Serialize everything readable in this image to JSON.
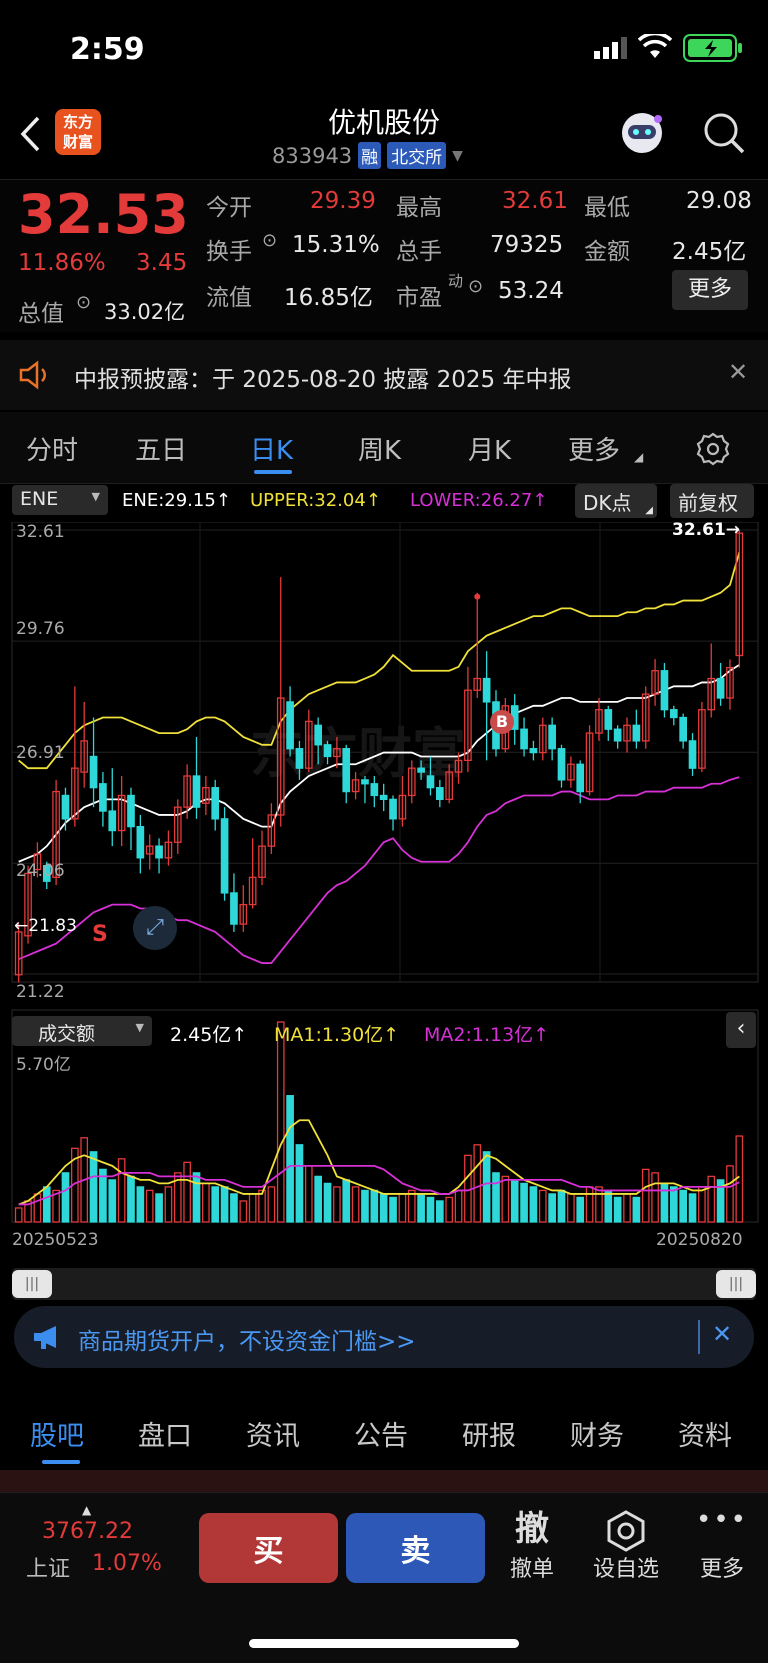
{
  "status": {
    "time": "2:59"
  },
  "nav": {
    "logo_line1": "东方",
    "logo_line2": "财富",
    "title": "优机股份",
    "code": "833943",
    "tag_margin": "融",
    "tag_exchange": "北交所"
  },
  "quote": {
    "price": "32.53",
    "change_pct": "11.86%",
    "change_amt": "3.45",
    "open_label": "今开",
    "open": "29.39",
    "high_label": "最高",
    "high": "32.61",
    "low_label": "最低",
    "low": "29.08",
    "turnover_label": "换手",
    "turnover": "15.31%",
    "vol_label": "总手",
    "vol": "79325",
    "amount_label": "金额",
    "amount": "2.45亿",
    "mcap_label": "总值",
    "mcap": "33.02亿",
    "float_label": "流值",
    "float": "16.85亿",
    "pe_label": "市盈",
    "pe_sup": "动",
    "pe": "53.24",
    "more": "更多"
  },
  "notice": {
    "text": "中报预披露：于 2025-08-20 披露 2025 年中报"
  },
  "tabs": [
    "分时",
    "五日",
    "日K",
    "周K",
    "月K",
    "更多"
  ],
  "indicator": {
    "name": "ENE",
    "ene": "ENE:29.15",
    "upper": "UPPER:32.04",
    "lower": "LOWER:26.27",
    "dk": "DK点",
    "adjust": "前复权",
    "last_tag": "32.61",
    "low_tag": "21.83",
    "s_mark": "S",
    "b_mark": "B"
  },
  "axis": {
    "y": [
      "32.61",
      "29.76",
      "26.91",
      "24.06",
      "21.22"
    ]
  },
  "volume": {
    "name": "成交额",
    "val": "2.45亿",
    "ma1": "MA1:1.30亿",
    "ma2": "MA2:1.13亿",
    "max": "5.70亿",
    "date_start": "20250523",
    "date_end": "20250820"
  },
  "banner": {
    "text": "商品期货开户，不设资金门槛>>"
  },
  "subtabs": [
    "股吧",
    "盘口",
    "资讯",
    "公告",
    "研报",
    "财务",
    "资料"
  ],
  "bottom": {
    "index_val": "3767.22",
    "index_name": "上证",
    "index_pct": "1.07%",
    "buy": "买",
    "sell": "卖",
    "cancel_top": "撤",
    "cancel": "撤单",
    "fav": "设自选",
    "more": "更多"
  },
  "colors": {
    "up": "#e33a3a",
    "down": "#2fd8d8",
    "accent": "#3b8ef0",
    "upper": "#f0e03a",
    "lower": "#d631d6",
    "ene": "#ffffff"
  },
  "chart_data": {
    "type": "candlestick",
    "y_range": [
      21.22,
      32.61
    ],
    "candles": [
      [
        21.2,
        22.3,
        21.0,
        22.5
      ],
      [
        22.2,
        23.8,
        22.0,
        24.0
      ],
      [
        23.9,
        24.3,
        23.7,
        24.6
      ],
      [
        24.0,
        23.6,
        23.4,
        24.1
      ],
      [
        23.7,
        25.9,
        23.5,
        26.2
      ],
      [
        25.8,
        25.2,
        24.9,
        26.0
      ],
      [
        25.2,
        26.5,
        25.0,
        28.6
      ],
      [
        26.4,
        27.2,
        26.0,
        28.2
      ],
      [
        26.8,
        26.0,
        25.5,
        27.8
      ],
      [
        26.1,
        25.4,
        25.0,
        26.4
      ],
      [
        25.4,
        24.9,
        24.5,
        26.5
      ],
      [
        24.9,
        25.8,
        24.5,
        26.3
      ],
      [
        25.8,
        25.0,
        24.4,
        26.0
      ],
      [
        25.0,
        24.2,
        23.8,
        25.3
      ],
      [
        24.3,
        24.5,
        23.9,
        24.8
      ],
      [
        24.5,
        24.2,
        23.8,
        24.7
      ],
      [
        24.2,
        24.6,
        24.0,
        24.9
      ],
      [
        24.6,
        25.5,
        24.3,
        25.7
      ],
      [
        25.5,
        26.3,
        25.2,
        26.6
      ],
      [
        26.3,
        25.5,
        25.2,
        27.3
      ],
      [
        25.6,
        26.0,
        25.3,
        26.3
      ],
      [
        26.0,
        25.2,
        24.9,
        26.2
      ],
      [
        25.2,
        23.3,
        23.1,
        25.5
      ],
      [
        23.3,
        22.5,
        22.3,
        23.8
      ],
      [
        22.5,
        23.0,
        22.3,
        23.5
      ],
      [
        23.0,
        23.7,
        22.9,
        24.7
      ],
      [
        23.7,
        24.5,
        23.5,
        24.9
      ],
      [
        24.5,
        25.3,
        24.3,
        25.6
      ],
      [
        25.3,
        28.3,
        25.0,
        31.4
      ],
      [
        28.2,
        27.0,
        26.8,
        28.6
      ],
      [
        27.0,
        26.5,
        26.2,
        27.2
      ],
      [
        26.5,
        27.7,
        26.4,
        28.0
      ],
      [
        27.6,
        27.1,
        26.6,
        27.8
      ],
      [
        27.1,
        26.8,
        26.6,
        27.2
      ],
      [
        26.8,
        27.0,
        26.5,
        27.3
      ],
      [
        27.0,
        25.9,
        25.6,
        27.1
      ],
      [
        25.9,
        26.2,
        25.7,
        26.4
      ],
      [
        26.2,
        26.1,
        25.6,
        26.3
      ],
      [
        26.1,
        25.8,
        25.5,
        26.3
      ],
      [
        25.8,
        25.7,
        25.4,
        26.1
      ],
      [
        25.7,
        25.2,
        24.9,
        25.8
      ],
      [
        25.2,
        25.8,
        25.0,
        26.3
      ],
      [
        25.8,
        26.5,
        25.6,
        26.7
      ],
      [
        26.5,
        26.4,
        26.2,
        26.7
      ],
      [
        26.3,
        26.0,
        25.8,
        26.8
      ],
      [
        26.0,
        25.7,
        25.5,
        26.2
      ],
      [
        25.7,
        26.4,
        25.6,
        26.6
      ],
      [
        26.4,
        26.7,
        26.1,
        26.9
      ],
      [
        26.7,
        28.5,
        26.4,
        29.1
      ],
      [
        28.5,
        28.8,
        28.3,
        31.0
      ],
      [
        28.8,
        28.2,
        26.7,
        29.5
      ],
      [
        28.2,
        27.0,
        26.8,
        28.5
      ],
      [
        27.0,
        28.1,
        26.9,
        28.3
      ],
      [
        28.1,
        27.5,
        27.1,
        28.4
      ],
      [
        27.5,
        27.0,
        26.8,
        27.8
      ],
      [
        27.0,
        26.9,
        26.7,
        27.2
      ],
      [
        26.9,
        27.6,
        26.7,
        27.8
      ],
      [
        27.6,
        27.0,
        26.7,
        27.8
      ],
      [
        27.0,
        26.2,
        26.0,
        27.1
      ],
      [
        26.2,
        26.6,
        26.0,
        26.8
      ],
      [
        26.6,
        25.9,
        25.6,
        26.7
      ],
      [
        25.9,
        27.4,
        25.8,
        27.6
      ],
      [
        27.4,
        28.0,
        27.2,
        28.3
      ],
      [
        28.0,
        27.5,
        27.2,
        28.1
      ],
      [
        27.5,
        27.2,
        27.0,
        27.6
      ],
      [
        27.2,
        27.6,
        26.9,
        27.8
      ],
      [
        27.6,
        27.2,
        27.0,
        28.0
      ],
      [
        27.2,
        28.4,
        27.0,
        28.6
      ],
      [
        28.4,
        29.0,
        28.1,
        29.3
      ],
      [
        29.0,
        28.0,
        27.8,
        29.2
      ],
      [
        28.0,
        27.8,
        27.6,
        28.1
      ],
      [
        27.8,
        27.2,
        27.0,
        27.9
      ],
      [
        27.2,
        26.5,
        26.3,
        27.4
      ],
      [
        26.5,
        28.0,
        26.4,
        28.2
      ],
      [
        28.0,
        28.8,
        27.8,
        29.7
      ],
      [
        28.8,
        28.3,
        28.1,
        29.2
      ],
      [
        28.3,
        29.08,
        28.0,
        29.29
      ],
      [
        29.39,
        32.53,
        29.08,
        32.61
      ]
    ],
    "ene": [
      24.1,
      24.2,
      24.3,
      24.5,
      24.8,
      25.1,
      25.3,
      25.5,
      25.6,
      25.7,
      25.7,
      25.7,
      25.6,
      25.5,
      25.4,
      25.3,
      25.3,
      25.3,
      25.4,
      25.6,
      25.7,
      25.7,
      25.6,
      25.4,
      25.2,
      25.1,
      25.0,
      25.0,
      25.6,
      25.9,
      26.1,
      26.3,
      26.4,
      26.5,
      26.6,
      26.6,
      26.6,
      26.7,
      26.8,
      26.9,
      26.9,
      26.9,
      26.9,
      26.8,
      26.8,
      26.8,
      26.8,
      26.8,
      26.9,
      27.2,
      27.4,
      27.6,
      27.8,
      27.9,
      28.0,
      28.1,
      28.1,
      28.2,
      28.3,
      28.3,
      28.2,
      28.2,
      28.2,
      28.2,
      28.2,
      28.3,
      28.3,
      28.3,
      28.4,
      28.5,
      28.6,
      28.6,
      28.6,
      28.7,
      28.7,
      28.8,
      29.0,
      29.15
    ],
    "upper": [
      26.7,
      26.5,
      26.5,
      26.5,
      26.8,
      27.1,
      27.4,
      27.6,
      27.7,
      27.8,
      27.8,
      27.8,
      27.7,
      27.6,
      27.5,
      27.4,
      27.4,
      27.4,
      27.5,
      27.7,
      27.8,
      27.8,
      27.7,
      27.5,
      27.3,
      27.2,
      27.1,
      27.1,
      27.7,
      28.0,
      28.2,
      28.4,
      28.5,
      28.6,
      28.7,
      28.7,
      28.7,
      28.8,
      28.9,
      29.1,
      29.4,
      29.2,
      29.0,
      29.0,
      29.0,
      29.0,
      29.0,
      29.1,
      29.5,
      29.7,
      29.9,
      30.0,
      30.1,
      30.2,
      30.3,
      30.4,
      30.4,
      30.5,
      30.6,
      30.6,
      30.5,
      30.4,
      30.4,
      30.4,
      30.4,
      30.5,
      30.5,
      30.6,
      30.6,
      30.7,
      30.7,
      30.8,
      30.8,
      30.8,
      30.9,
      31.0,
      31.2,
      32.04
    ],
    "lower": [
      21.6,
      21.7,
      21.8,
      21.9,
      22.0,
      22.2,
      22.4,
      22.6,
      22.8,
      22.9,
      23.0,
      23.0,
      23.0,
      22.9,
      22.9,
      22.8,
      22.7,
      22.6,
      22.6,
      22.5,
      22.4,
      22.3,
      22.1,
      21.9,
      21.7,
      21.6,
      21.5,
      21.5,
      21.8,
      22.1,
      22.4,
      22.7,
      23.0,
      23.3,
      23.5,
      23.6,
      23.8,
      24.0,
      24.3,
      24.6,
      24.7,
      24.4,
      24.2,
      24.1,
      24.1,
      24.1,
      24.1,
      24.3,
      24.6,
      25.0,
      25.3,
      25.4,
      25.6,
      25.7,
      25.8,
      25.8,
      25.8,
      25.8,
      25.9,
      25.9,
      25.8,
      25.7,
      25.7,
      25.7,
      25.8,
      25.8,
      25.8,
      25.9,
      25.9,
      25.9,
      26.0,
      26.0,
      26.0,
      26.0,
      26.1,
      26.1,
      26.2,
      26.27
    ],
    "vol_max": 5.7,
    "volumes": [
      0.4,
      0.6,
      0.8,
      1.0,
      0.9,
      1.4,
      2.1,
      2.4,
      2.0,
      1.5,
      1.2,
      1.8,
      1.3,
      1.0,
      0.9,
      0.8,
      1.0,
      1.4,
      1.7,
      1.4,
      1.1,
      1.0,
      1.0,
      0.8,
      0.6,
      0.8,
      0.9,
      1.0,
      5.7,
      3.6,
      2.2,
      1.6,
      1.3,
      1.1,
      1.0,
      1.2,
      1.0,
      0.9,
      0.9,
      0.8,
      0.7,
      0.8,
      0.9,
      0.8,
      0.7,
      0.6,
      0.7,
      0.9,
      1.9,
      2.2,
      2.0,
      1.4,
      1.3,
      1.2,
      1.1,
      1.0,
      0.9,
      0.8,
      0.9,
      0.8,
      0.7,
      1.0,
      1.0,
      0.9,
      0.7,
      0.8,
      0.7,
      1.5,
      1.4,
      1.1,
      1.0,
      0.9,
      0.8,
      1.0,
      1.3,
      1.2,
      1.6,
      2.45
    ],
    "ma1": [
      0.5,
      0.6,
      0.8,
      1.0,
      1.3,
      1.6,
      1.8,
      1.9,
      1.8,
      1.7,
      1.6,
      1.4,
      1.3,
      1.2,
      1.2,
      1.1,
      1.1,
      1.2,
      1.2,
      1.1,
      1.1,
      1.1,
      1.0,
      0.9,
      0.8,
      0.8,
      0.8,
      1.5,
      2.2,
      2.7,
      2.9,
      2.9,
      2.4,
      1.9,
      1.3,
      1.2,
      1.1,
      1.0,
      0.9,
      0.8,
      0.8,
      0.8,
      0.8,
      0.8,
      0.8,
      0.8,
      0.8,
      1.0,
      1.3,
      1.6,
      1.9,
      1.8,
      1.6,
      1.4,
      1.2,
      1.1,
      1.0,
      0.9,
      0.9,
      0.8,
      0.8,
      0.8,
      0.8,
      0.8,
      0.8,
      0.8,
      0.8,
      1.0,
      1.1,
      1.1,
      1.1,
      1.0,
      0.9,
      0.9,
      1.0,
      1.0,
      1.1,
      1.3
    ],
    "ma2": [
      0.5,
      0.5,
      0.6,
      0.7,
      0.8,
      0.9,
      1.1,
      1.2,
      1.3,
      1.3,
      1.3,
      1.4,
      1.4,
      1.4,
      1.4,
      1.3,
      1.3,
      1.3,
      1.3,
      1.3,
      1.2,
      1.2,
      1.2,
      1.1,
      1.0,
      1.0,
      1.0,
      1.2,
      1.4,
      1.6,
      1.6,
      1.6,
      1.6,
      1.6,
      1.6,
      1.6,
      1.6,
      1.6,
      1.6,
      1.5,
      1.3,
      1.1,
      1.0,
      0.9,
      0.9,
      0.8,
      0.8,
      0.9,
      0.9,
      1.0,
      1.1,
      1.1,
      1.2,
      1.2,
      1.2,
      1.2,
      1.2,
      1.2,
      1.2,
      1.1,
      1.0,
      1.0,
      0.9,
      0.9,
      0.9,
      0.9,
      0.9,
      0.9,
      0.9,
      0.9,
      0.9,
      1.0,
      1.0,
      1.0,
      1.0,
      1.0,
      1.0,
      1.13
    ]
  }
}
